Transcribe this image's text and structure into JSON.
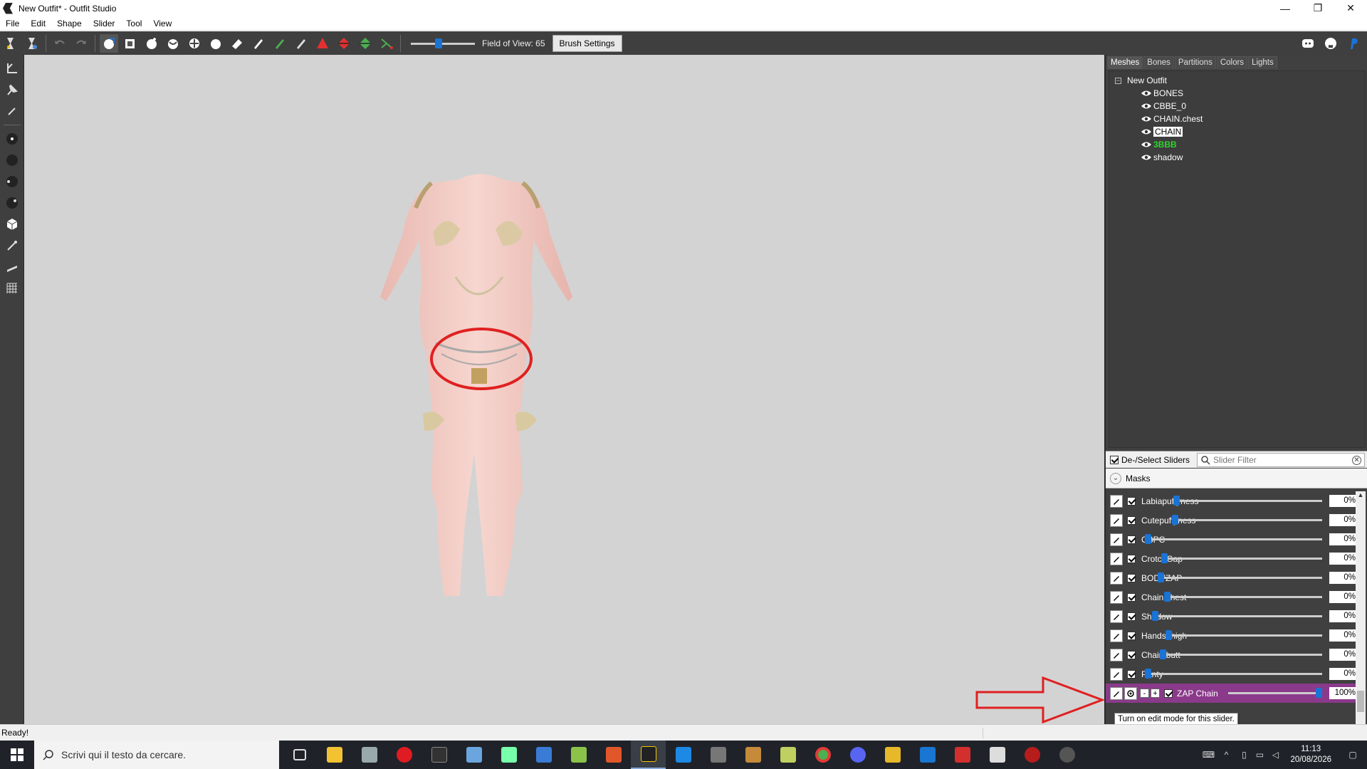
{
  "window": {
    "title": "New Outfit* - Outfit Studio",
    "minimize": "—",
    "restore": "❐",
    "close": "✕"
  },
  "menu": [
    "File",
    "Edit",
    "Shape",
    "Slider",
    "Tool",
    "View"
  ],
  "toolbar": {
    "fov_label": "Field of View: 65",
    "fov_value": 65,
    "brush_settings": "Brush Settings"
  },
  "right_panel": {
    "tabs": [
      "Meshes",
      "Bones",
      "Partitions",
      "Colors",
      "Lights"
    ],
    "active_tab": "Meshes",
    "tree_root": "New Outfit",
    "tree_items": [
      {
        "label": "BONES",
        "state": "normal"
      },
      {
        "label": "CBBE_0",
        "state": "normal"
      },
      {
        "label": "CHAIN.chest",
        "state": "normal"
      },
      {
        "label": "CHAIN",
        "state": "selected"
      },
      {
        "label": "3BBB",
        "state": "zapped"
      },
      {
        "label": "shadow",
        "state": "normal"
      }
    ],
    "deselect_label": "De-/Select Sliders",
    "slider_filter_placeholder": "Slider Filter",
    "masks_label": "Masks",
    "sliders": [
      {
        "name": "Labiapuffyness",
        "value": "0%",
        "level": 0
      },
      {
        "name": "Cutepuffyness",
        "value": "0%",
        "level": 0
      },
      {
        "name": "CBPC",
        "value": "0%",
        "level": 0
      },
      {
        "name": "CrotchGap",
        "value": "0%",
        "level": 0
      },
      {
        "name": "BODYZAP",
        "value": "0%",
        "level": 0
      },
      {
        "name": "Chain chest",
        "value": "0%",
        "level": 0
      },
      {
        "name": "Shadow",
        "value": "0%",
        "level": 0
      },
      {
        "name": "Hands thigh",
        "value": "0%",
        "level": 0
      },
      {
        "name": "Chain butt",
        "value": "0%",
        "level": 0
      },
      {
        "name": "Panty",
        "value": "0%",
        "level": 0
      }
    ],
    "active_slider": {
      "name": "ZAP Chain",
      "value": "100%",
      "level": 1.0
    },
    "tooltip": "Turn on edit mode for this slider."
  },
  "statusbar": {
    "text": "Ready!"
  },
  "taskbar": {
    "search_placeholder": "Scrivi qui il testo da cercare.",
    "time": "11:13",
    "date": "20/08/2026"
  },
  "colors": {
    "panel_bg": "#404040",
    "viewport_bg": "#d3d3d3",
    "slider_accent": "#1a73d6",
    "active_slider_bg": "#8b3a8b",
    "zapped_mesh": "#2bd82b",
    "annotation_red": "#e02020"
  }
}
